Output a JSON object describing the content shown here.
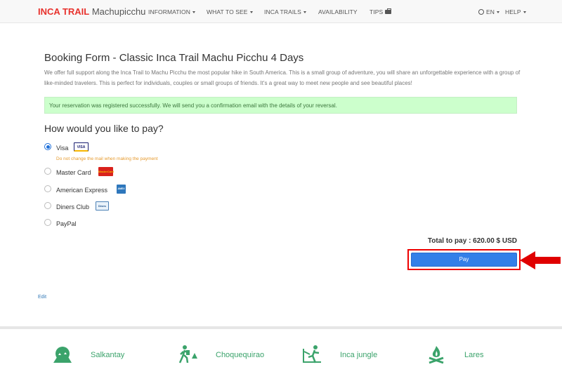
{
  "brand": {
    "primary": "INCA TRAIL",
    "secondary": "Machupicchu"
  },
  "nav": {
    "information": "INFORMATION",
    "what_to_see": "WHAT TO SEE",
    "inca_trails": "INCA TRAILS",
    "availability": "AVAILABILITY",
    "tips": "TIPS",
    "language": "EN",
    "help": "HELP"
  },
  "booking": {
    "title": "Booking Form - Classic Inca Trail Machu Picchu 4 Days",
    "description": "We offer full support along the Inca Trail to Machu Picchu the most popular hike in South America. This is a small group of adventure, you will share an unforgettable experience with a group of like-minded travelers. This is perfect for individuals, couples or small groups of friends. It's a great way to meet new people and see beautiful places!",
    "success_message": "Your reservation was registered successfully. We will send you a confirmation email with the details of your reversal.",
    "pay_question": "How would you like to pay?",
    "payment_options": [
      {
        "label": "Visa",
        "selected": true,
        "icon_text": "VISA"
      },
      {
        "label": "Master Card",
        "selected": false,
        "icon_text": "MasterCard"
      },
      {
        "label": "American Express",
        "selected": false,
        "icon_text": "AMEX"
      },
      {
        "label": "Diners Club",
        "selected": false,
        "icon_text": "Diners"
      },
      {
        "label": "PayPal",
        "selected": false,
        "icon_text": ""
      }
    ],
    "visa_warning": "Do not change the mail when making the payment",
    "total_label": "Total to pay : 620.00 $ USD",
    "pay_button": "Pay",
    "edit_link": "Edit"
  },
  "footer": {
    "items": [
      {
        "label": "Salkantay",
        "icon": "mountain-icon"
      },
      {
        "label": "Choquequirao",
        "icon": "hiker-icon"
      },
      {
        "label": "Inca jungle",
        "icon": "biker-icon"
      },
      {
        "label": "Lares",
        "icon": "campfire-icon"
      }
    ]
  },
  "colors": {
    "brand_red": "#e8322d",
    "pay_blue": "#337fe8",
    "success_bg": "#ccffcc",
    "footer_green": "#3ba36b",
    "highlight_red": "#e00000"
  }
}
